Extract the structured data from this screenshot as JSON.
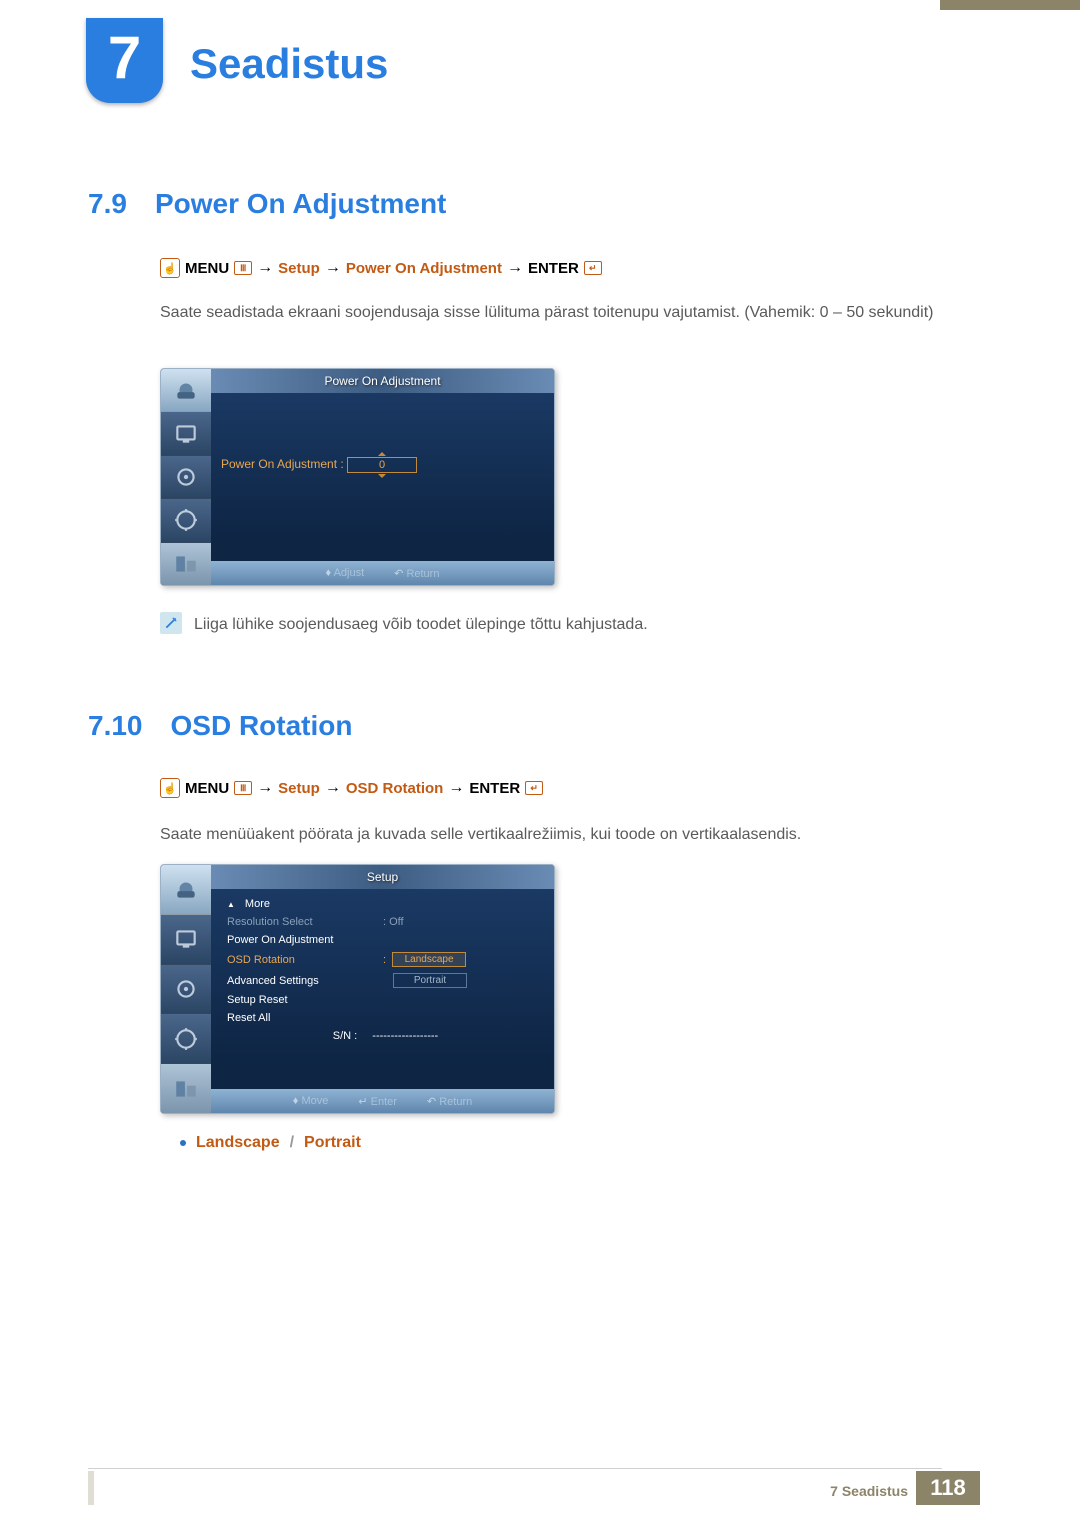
{
  "chapter": {
    "number": "7",
    "title": "Seadistus"
  },
  "section79": {
    "num": "7.9",
    "title": "Power On Adjustment",
    "navpath": {
      "menu": "MENU",
      "setup": "Setup",
      "item": "Power On Adjustment",
      "enter": "ENTER"
    },
    "body": "Saate seadistada ekraani soojendusaja sisse lülituma pärast toitenupu vajutamist. (Vahemik: 0 – 50 sekundit)",
    "osd": {
      "title": "Power On Adjustment",
      "row_label": "Power On Adjustment :",
      "value": "0",
      "footer": {
        "adjust": "Adjust",
        "return": "Return"
      }
    },
    "note": "Liiga lühike soojendusaeg võib toodet ülepinge tõttu kahjustada."
  },
  "section710": {
    "num": "7.10",
    "title": "OSD Rotation",
    "navpath": {
      "menu": "MENU",
      "setup": "Setup",
      "item": "OSD Rotation",
      "enter": "ENTER"
    },
    "body": "Saate menüüakent pöörata ja kuvada selle vertikaalrežiimis, kui toode on vertikaalasendis.",
    "osd": {
      "title": "Setup",
      "more": "More",
      "rows": {
        "resolution": {
          "label": "Resolution Select",
          "value": "Off"
        },
        "poa": {
          "label": "Power On Adjustment"
        },
        "osdrot": {
          "label": "OSD Rotation"
        },
        "adv": {
          "label": "Advanced Settings"
        },
        "reset": {
          "label": "Setup Reset"
        },
        "resetall": {
          "label": "Reset All"
        },
        "sn": {
          "label": "S/N :",
          "value": "------------------"
        }
      },
      "options": {
        "landscape": "Landscape",
        "portrait": "Portrait"
      },
      "footer": {
        "move": "Move",
        "enter": "Enter",
        "return": "Return"
      }
    },
    "bullet": {
      "opt1": "Landscape",
      "sep": "/",
      "opt2": "Portrait"
    }
  },
  "footer": {
    "label": "7 Seadistus",
    "page": "118"
  },
  "icons": {
    "sidebar": [
      "picture-icon",
      "screen-icon",
      "sound-icon",
      "setup-icon",
      "multi-icon"
    ]
  }
}
